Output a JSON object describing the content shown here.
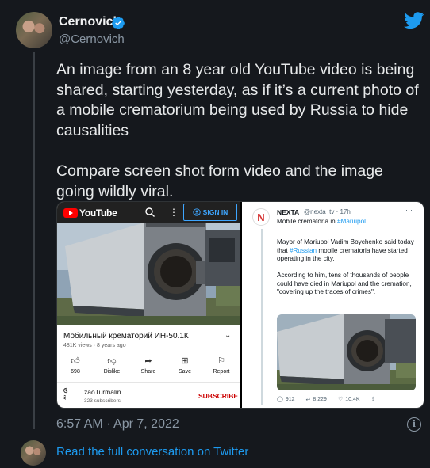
{
  "author": {
    "name": "Cernovich",
    "handle": "@Cernovich"
  },
  "tweet": {
    "paragraph1": "An image from an 8 year old YouTube video is being shared, starting yesterday, as if it’s a current photo of a mobile crematorium being used by Russia to hide causalities",
    "paragraph2": "Compare screen shot form video and the image going wildly viral."
  },
  "youtube": {
    "logo_text": "YouTube",
    "signin_label": "SIGN IN",
    "video_title": "Мобильный крематорий ИН-50.1К",
    "video_meta": "481K views · 8 years ago",
    "actions": [
      {
        "label": "698",
        "icon": "thumbs-up-icon"
      },
      {
        "label": "Dislike",
        "icon": "thumbs-down-icon"
      },
      {
        "label": "Share",
        "icon": "share-icon"
      },
      {
        "label": "Save",
        "icon": "save-icon"
      },
      {
        "label": "Report",
        "icon": "flag-icon"
      }
    ],
    "channel_name": "zaoTurmalin",
    "subscribers": "323 subscribers",
    "subscribe_label": "SUBSCRIBE"
  },
  "embedded_tweet": {
    "name": "NEXTA",
    "handle": "@nexta_tv · 17h",
    "line1_prefix": "Mobile crematoria in ",
    "line1_hashtag": "#Mariupol",
    "body1_prefix": "Mayor of Mariupol Vadim Boychenko said today that ",
    "body1_hashtag": "#Russian",
    "body1_suffix": " mobile crematoria have started operating in the city.",
    "body2": "According to him, tens of thousands of people could have died in Mariupol and the cremation, \"covering up the traces of crimes\".",
    "replies": "912",
    "retweets": "8,229",
    "likes": "10.4K"
  },
  "footer": {
    "timestamp": "6:57 AM · Apr 7, 2022",
    "read_full_conversation": "Read the full conversation on Twitter"
  },
  "colors": {
    "background": "#15181d",
    "link": "#1d9bf0",
    "youtube_red": "#ff0000"
  }
}
